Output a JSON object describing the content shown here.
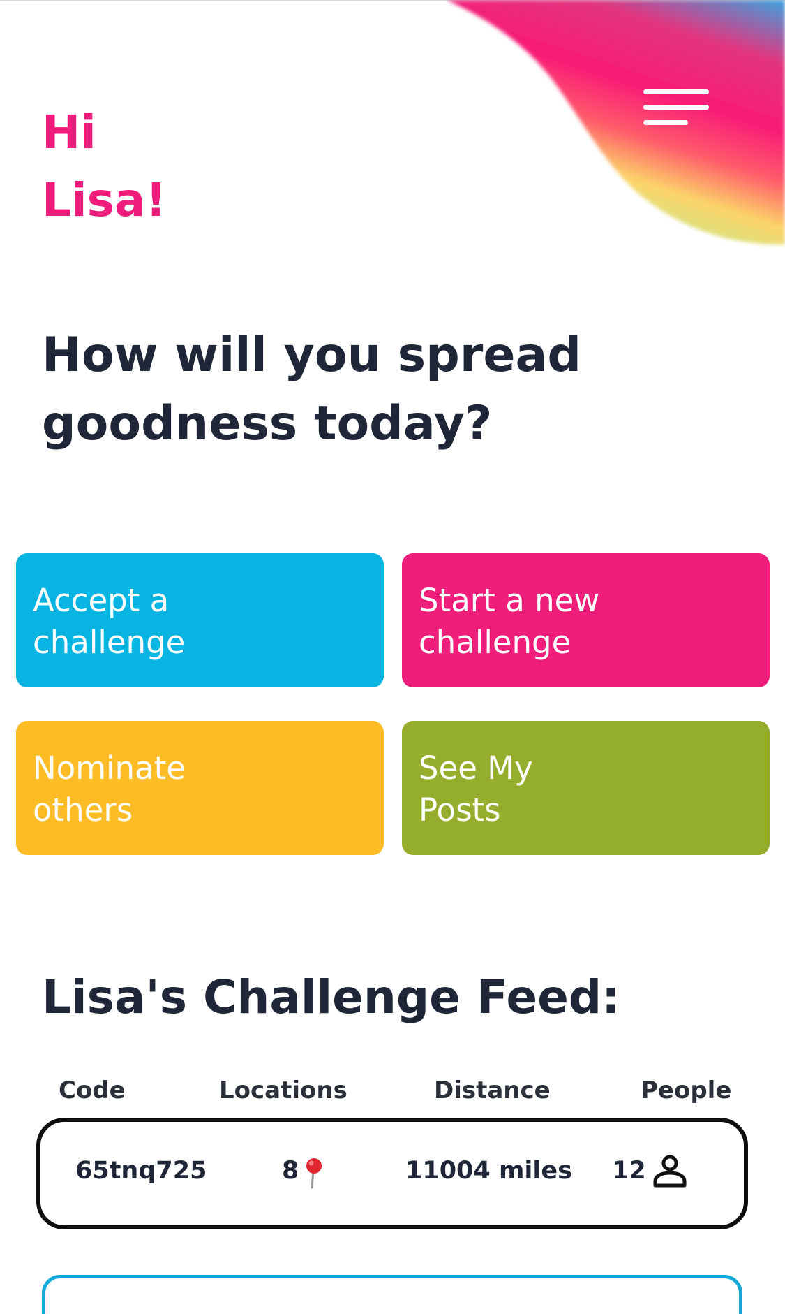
{
  "greeting": {
    "line1": "Hi",
    "line2": "Lisa!"
  },
  "header": {
    "menu_icon": "hamburger-menu-icon"
  },
  "prompt": {
    "line1": "How will you spread",
    "line2": "goodness today?"
  },
  "actions": [
    {
      "line1": "Accept a",
      "line2": "challenge",
      "color": "#08b4e2"
    },
    {
      "line1": "Start a new",
      "line2": "challenge",
      "color": "#ef1e7b"
    },
    {
      "line1": "Nominate",
      "line2": "others",
      "color": "#fdbc25"
    },
    {
      "line1": "See My",
      "line2": "Posts",
      "color": "#95ad2d"
    }
  ],
  "feed": {
    "title": "Lisa's Challenge Feed:",
    "columns": [
      "Code",
      "Locations",
      "Distance",
      "People"
    ],
    "rows": [
      {
        "code": "65tnq725",
        "locations": "8",
        "distance": "11004 miles",
        "people": "12"
      }
    ]
  },
  "colors": {
    "accent_pink": "#ee1d7b",
    "heading_dark": "#1e2637",
    "card_border": "#0d0d0d",
    "next_card_border": "#13a9d9"
  },
  "icons": {
    "location": "map-pin-icon",
    "people": "person-icon"
  }
}
